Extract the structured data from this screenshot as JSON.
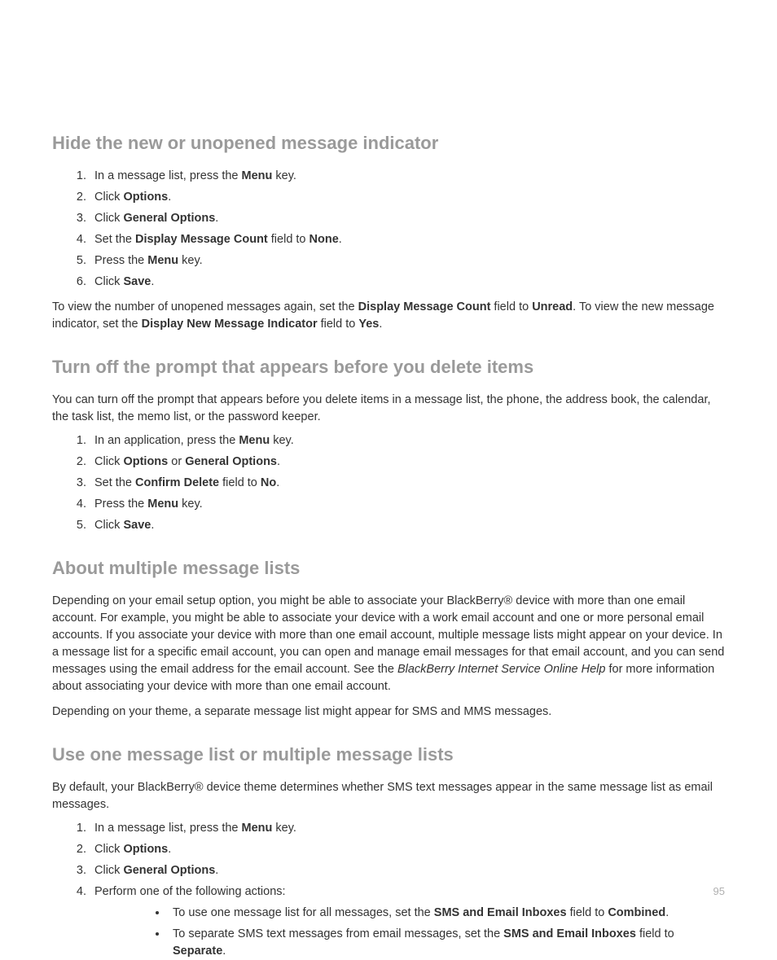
{
  "section1": {
    "heading": "Hide the new or unopened message indicator",
    "steps": {
      "s1_pre": "In a message list, press the ",
      "s1_b": "Menu",
      "s1_post": " key.",
      "s2_pre": "Click ",
      "s2_b": "Options",
      "s2_post": ".",
      "s3_pre": "Click ",
      "s3_b": "General Options",
      "s3_post": ".",
      "s4_pre": "Set the ",
      "s4_b1": "Display Message Count",
      "s4_mid": " field to ",
      "s4_b2": "None",
      "s4_post": ".",
      "s5_pre": "Press the ",
      "s5_b": "Menu",
      "s5_post": " key.",
      "s6_pre": "Click ",
      "s6_b": "Save",
      "s6_post": "."
    },
    "para": {
      "p1": "To view the number of unopened messages again, set the ",
      "b1": "Display Message Count",
      "p2": " field to ",
      "b2": "Unread",
      "p3": ". To view the new message indicator, set the ",
      "b3": "Display New Message Indicator",
      "p4": " field to ",
      "b4": "Yes",
      "p5": "."
    }
  },
  "section2": {
    "heading": "Turn off the prompt that appears before you delete items",
    "intro": "You can turn off the prompt that appears before you delete items in a message list, the phone, the address book, the calendar, the task list, the memo list, or the password keeper.",
    "steps": {
      "s1_pre": "In an application, press the ",
      "s1_b": "Menu",
      "s1_post": " key.",
      "s2_pre": "Click ",
      "s2_b1": "Options",
      "s2_mid": " or ",
      "s2_b2": "General Options",
      "s2_post": ".",
      "s3_pre": "Set the ",
      "s3_b1": "Confirm Delete",
      "s3_mid": " field to ",
      "s3_b2": "No",
      "s3_post": ".",
      "s4_pre": "Press the ",
      "s4_b": "Menu",
      "s4_post": " key.",
      "s5_pre": "Click ",
      "s5_b": "Save",
      "s5_post": "."
    }
  },
  "section3": {
    "heading": "About multiple message lists",
    "para1_pre": "Depending on your email setup option, you might be able to associate your BlackBerry® device with more than one email account. For example, you might be able to associate your device with a work email account and one or more personal email accounts. If you associate your device with more than one email account, multiple message lists might appear on your device. In a message list for a specific email account, you can open and manage email messages for that email account, and you can send messages using the email address for the email account. See the  ",
    "para1_italic": "BlackBerry Internet Service Online Help",
    "para1_post": " for more information about associating your device with more than one email account.",
    "para2": "Depending on your theme, a separate message list might appear for SMS and MMS messages."
  },
  "section4": {
    "heading": "Use one message list or multiple message lists",
    "intro": "By default, your BlackBerry® device theme determines whether SMS text messages appear in the same message list as email messages.",
    "steps": {
      "s1_pre": "In a message list, press the ",
      "s1_b": "Menu",
      "s1_post": " key.",
      "s2_pre": "Click ",
      "s2_b": "Options",
      "s2_post": ".",
      "s3_pre": "Click ",
      "s3_b": "General Options",
      "s3_post": ".",
      "s4": "Perform one of the following actions:"
    },
    "bullets": {
      "b1_pre": "To use one message list for all messages, set the ",
      "b1_b1": "SMS and Email Inboxes",
      "b1_mid": " field to ",
      "b1_b2": "Combined",
      "b1_post": ".",
      "b2_pre": "To separate SMS text messages from email messages, set the ",
      "b2_b1": "SMS and Email Inboxes",
      "b2_mid": " field to ",
      "b2_b2": "Separate",
      "b2_post": "."
    }
  },
  "pageNumber": "95"
}
